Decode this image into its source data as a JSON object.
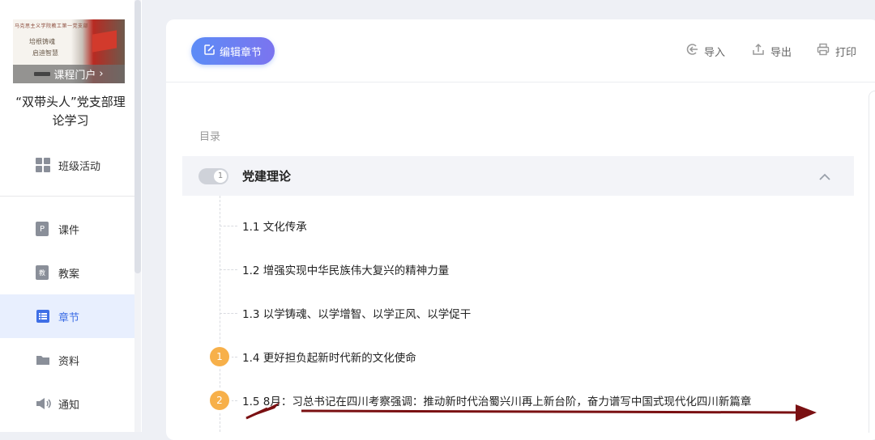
{
  "sidebar": {
    "cover": {
      "top_text": "马克思主义学院教工第一党支部",
      "slogan_line1": "培根铸魂",
      "slogan_line2": "启迪智慧",
      "portal_label": "课程门户",
      "portal_arrow": "›"
    },
    "course_title": "“双带头人”党支部理论学习",
    "items": [
      {
        "label": "班级活动",
        "icon": "grid-icon"
      },
      {
        "label": "课件",
        "icon": "ppt-icon"
      },
      {
        "label": "教案",
        "icon": "lesson-plan-icon"
      },
      {
        "label": "章节",
        "icon": "list-icon"
      },
      {
        "label": "资料",
        "icon": "folder-icon"
      },
      {
        "label": "通知",
        "icon": "speaker-icon"
      }
    ],
    "active_item": "章节",
    "active_color": "#3f6fe6"
  },
  "toolbar": {
    "edit_label": "编辑章节",
    "import_label": "导入",
    "export_label": "导出",
    "print_label": "打印"
  },
  "toc": {
    "label": "目录",
    "chapter": {
      "number": "1",
      "title": "党建理论"
    },
    "sections": [
      {
        "title": "1.1 文化传承",
        "badge": ""
      },
      {
        "title": "1.2 增强实现中华民族伟大复兴的精神力量",
        "badge": ""
      },
      {
        "title": "1.3 以学铸魂、以学增智、以学正风、以学促干",
        "badge": ""
      },
      {
        "title": "1.4 更好担负起新时代新的文化使命",
        "badge": "1"
      },
      {
        "title": "1.5 8月：习总书记在四川考察强调：推动新时代治蜀兴川再上新台阶，奋力谱写中国式现代化四川新篇章",
        "badge": "2"
      }
    ]
  },
  "colors": {
    "accent": "#5c8cf6",
    "badge": "#f7b04a",
    "annotation_arrow": "#7a1012"
  }
}
